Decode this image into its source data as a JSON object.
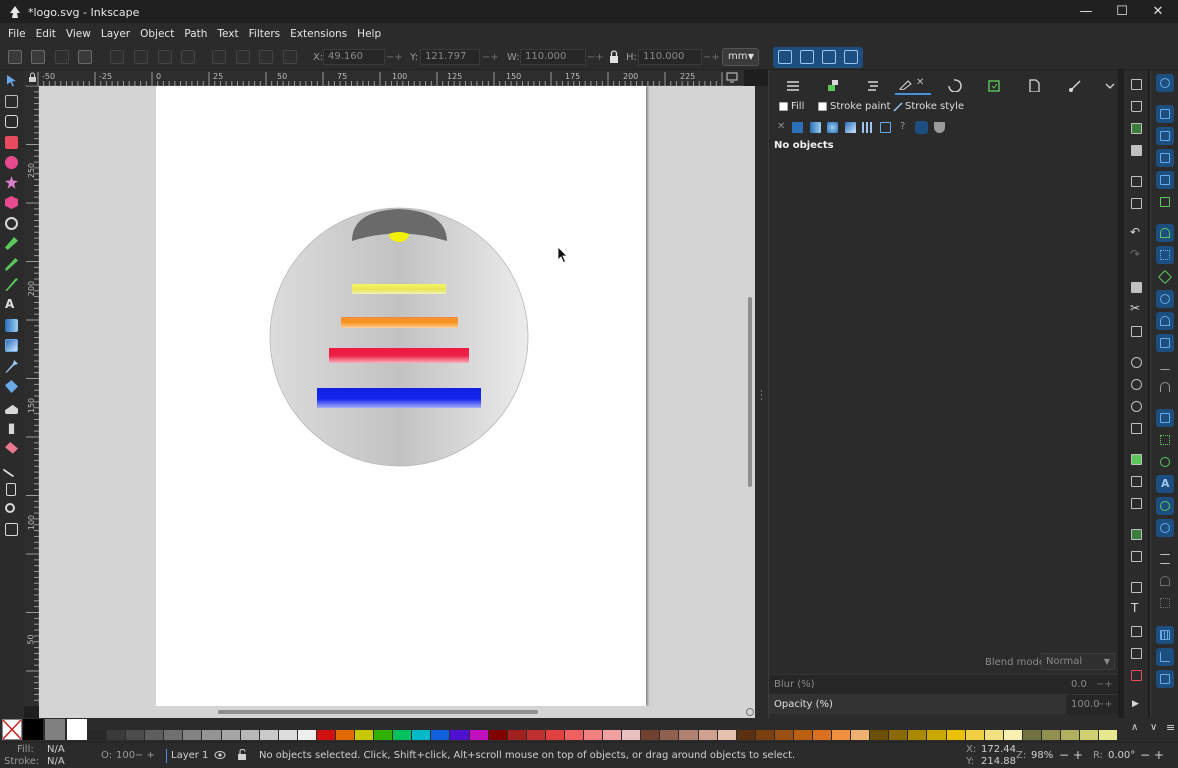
{
  "window": {
    "title": "*logo.svg - Inkscape",
    "minimize": "—",
    "maximize": "☐",
    "close": "✕"
  },
  "menu": [
    "File",
    "Edit",
    "View",
    "Layer",
    "Object",
    "Path",
    "Text",
    "Filters",
    "Extensions",
    "Help"
  ],
  "controls": {
    "x_label": "X:",
    "x_value": "49.160",
    "y_label": "Y:",
    "y_value": "121.797",
    "w_label": "W:",
    "w_value": "110.000",
    "h_label": "H:",
    "h_value": "110.000",
    "unit": "mm"
  },
  "ruler_h": [
    "-50",
    "-25",
    "0",
    "25",
    "50",
    "75",
    "100",
    "125",
    "150",
    "175",
    "200",
    "225"
  ],
  "ruler_v": [
    "250",
    "200",
    "150",
    "100",
    "50"
  ],
  "tools": [
    "selector",
    "node",
    "shape-builder",
    "rectangle",
    "ellipse",
    "star",
    "3dbox",
    "spiral",
    "pen",
    "pencil",
    "calligraphy",
    "text",
    "gradient",
    "mesh",
    "dropper",
    "paint-bucket",
    "tweak",
    "spray",
    "eraser",
    "connector",
    "pages",
    "zoom",
    "measure"
  ],
  "panel": {
    "fill_label": "Fill",
    "stroke_paint_label": "Stroke paint",
    "stroke_style_label": "Stroke style",
    "status": "No objects",
    "blend_label": "Blend mode:",
    "blend_value": "Normal",
    "blur_label": "Blur (%)",
    "blur_value": "0.0",
    "opacity_label": "Opacity (%)",
    "opacity_value": "100.0"
  },
  "status": {
    "fill_label": "Fill:",
    "fill_value": "N/A",
    "stroke_label": "Stroke:",
    "stroke_value": "N/A",
    "o_label": "O:",
    "o_value": "100",
    "layer": "Layer 1",
    "message": "No objects selected. Click, Shift+click, Alt+scroll mouse on top of objects, or drag around objects to select.",
    "x_label": "X:",
    "x_value": "172.44",
    "y_label": "Y:",
    "y_value": "214.88",
    "zoom_label": "Z:",
    "zoom_value": "98%",
    "rot_label": "R:",
    "rot_value": "0.00°"
  },
  "accent": "#1c4e80",
  "palette_colors": [
    "#000000",
    "#808080",
    "#ffffff"
  ]
}
